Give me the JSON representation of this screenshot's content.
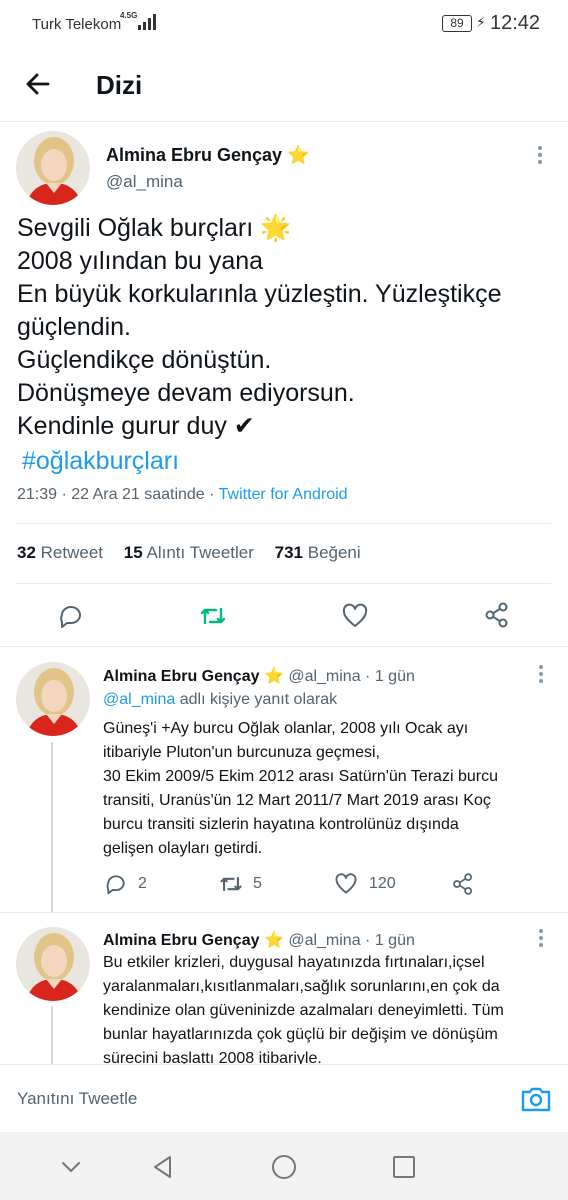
{
  "status_bar": {
    "carrier": "Turk Telekom",
    "network": "4.5G",
    "battery": "89",
    "time": "12:42"
  },
  "header": {
    "title": "Dizi"
  },
  "main_tweet": {
    "author_name": "Almina Ebru Gençay",
    "author_badge": "⭐",
    "handle": "@al_mina",
    "text_lines": [
      "Sevgili Oğlak burçları 🌟",
      "2008 yılından bu yana",
      "En büyük korkularınla yüzleştin. Yüzleştikçe",
      "güçlendin.",
      "Güçlendikçe dönüştün.",
      "Dönüşmeye devam ediyorsun.",
      "Kendinle gurur duy ✔"
    ],
    "hashtag": "#oğlakburçları",
    "timestamp": "21:39 · 22 Ara 21 saatinde · ",
    "client": "Twitter for Android",
    "stats": {
      "retweets_count": "32",
      "retweets_label": "Retweet",
      "quotes_count": "15",
      "quotes_label": "Alıntı Tweetler",
      "likes_count": "731",
      "likes_label": "Beğeni"
    }
  },
  "replies": [
    {
      "author_name": "Almina Ebru Gençay",
      "author_badge": "⭐",
      "handle_time": "@al_mina · 1 gün",
      "reply_to_mention": "@al_mina",
      "reply_to_suffix": " adlı kişiye yanıt olarak",
      "text_lines": [
        "Güneş'i +Ay burcu Oğlak olanlar, 2008 yılı Ocak ayı",
        "itibariyle Pluton'un burcunuza geçmesi,",
        "30 Ekim 2009/5 Ekim 2012 arası Satürn'ün Terazi burcu",
        "transiti, Uranüs'ün 12 Mart 2011/7 Mart 2019 arası Koç",
        "burcu transiti sizlerin hayatına kontrolünüz dışında",
        "gelişen olayları getirdi."
      ],
      "reply_count": "2",
      "retweet_count": "5",
      "like_count": "120"
    },
    {
      "author_name": "Almina Ebru Gençay",
      "author_badge": "⭐",
      "handle_time": "@al_mina · 1 gün",
      "text_lines": [
        "Bu etkiler krizleri, duygusal hayatınızda fırtınaları,içsel",
        "yaralanmaları,kısıtlanmaları,sağlık sorunlarını,en çok da",
        "kendinize olan güveninizde azalmaları deneyimletti. Tüm",
        "bunlar hayatlarınızda çok güçlü bir değişim ve dönüşüm",
        "sürecini başlattı 2008 itibariyle."
      ]
    }
  ],
  "compose": {
    "placeholder": "Yanıtını Tweetle"
  },
  "colors": {
    "accent": "#1d9bf0",
    "retweet_active": "#00ba7c",
    "secondary_text": "#536471"
  }
}
